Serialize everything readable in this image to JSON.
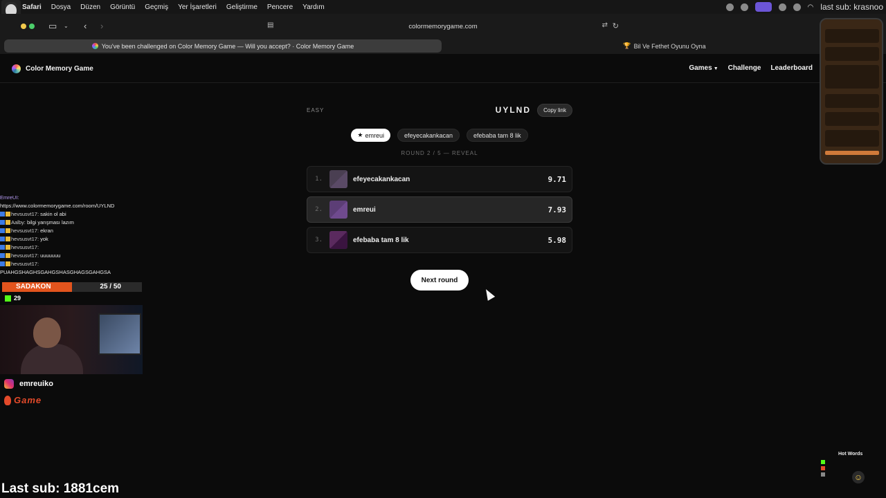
{
  "menubar": {
    "items": [
      "Safari",
      "Dosya",
      "Düzen",
      "Görüntü",
      "Geçmiş",
      "Yer İşaretleri",
      "Geliştirme",
      "Pencere",
      "Yardım"
    ],
    "overlay_text": "last sub: krasnoo"
  },
  "browser": {
    "url": "colormemorygame.com",
    "tabs": [
      {
        "label": "You've been challenged on Color Memory Game — Will you accept? · Color Memory Game",
        "active": true
      },
      {
        "label": "Bil Ve Fethet Oyunu Oyna",
        "active": false
      }
    ]
  },
  "site": {
    "brand": "Color Memory Game",
    "nav": [
      {
        "label": "Games",
        "has_dropdown": true
      },
      {
        "label": "Challenge",
        "has_dropdown": false
      },
      {
        "label": "Leaderboard",
        "has_dropdown": false
      }
    ]
  },
  "game": {
    "difficulty": "EASY",
    "room_code": "UYLND",
    "copy_label": "Copy link",
    "players": [
      {
        "name": "emreui",
        "is_me": true,
        "star": "★"
      },
      {
        "name": "efeyecakankacan",
        "is_me": false
      },
      {
        "name": "efebaba tam 8 lik",
        "is_me": false
      }
    ],
    "round_label": "ROUND 2 / 5 — REVEAL",
    "results": [
      {
        "rank": "1.",
        "name": "efeyecakankacan",
        "score": "9.71",
        "color_a": "#4a3f52",
        "color_b": "#5a4a66",
        "highlight": false
      },
      {
        "rank": "2.",
        "name": "emreui",
        "score": "7.93",
        "color_a": "#5c3e76",
        "color_b": "#6f4a8e",
        "highlight": true
      },
      {
        "rank": "3.",
        "name": "efebaba tam 8 lik",
        "score": "5.98",
        "color_a": "#5a2a5e",
        "color_b": "#3a1440",
        "highlight": false
      }
    ],
    "next_label": "Next round"
  },
  "stream": {
    "chat": [
      {
        "user": "EmreUI:",
        "text": "",
        "purple": true
      },
      {
        "user": "",
        "text": "https://www.colormemorygame.com/room/UYLND"
      },
      {
        "user": "hevsusvt17:",
        "text": "sakin ol abi"
      },
      {
        "user": "Aalby:",
        "text": "bilgi yarışması lazım"
      },
      {
        "user": "hevsusvt17:",
        "text": "ekran"
      },
      {
        "user": "hevsusvt17:",
        "text": "yok"
      },
      {
        "user": "hevsusvt17:",
        "text": ""
      },
      {
        "user": "hevsusvt17:",
        "text": "uuuuuuu"
      },
      {
        "user": "hevsusvt17:",
        "text": ""
      },
      {
        "user": "",
        "text": "PUAHGSHAGHSGAHGSHASGHAGSGAHGSA"
      }
    ],
    "sub_goal": {
      "name": "SADAKON",
      "count": "25 / 50",
      "progress": 0.5
    },
    "kick_count": "29",
    "instagram": "emreuiko",
    "brand_tag": "Game",
    "last_sub": "Last sub: 1881cem",
    "hot_words": "Hot Words"
  }
}
